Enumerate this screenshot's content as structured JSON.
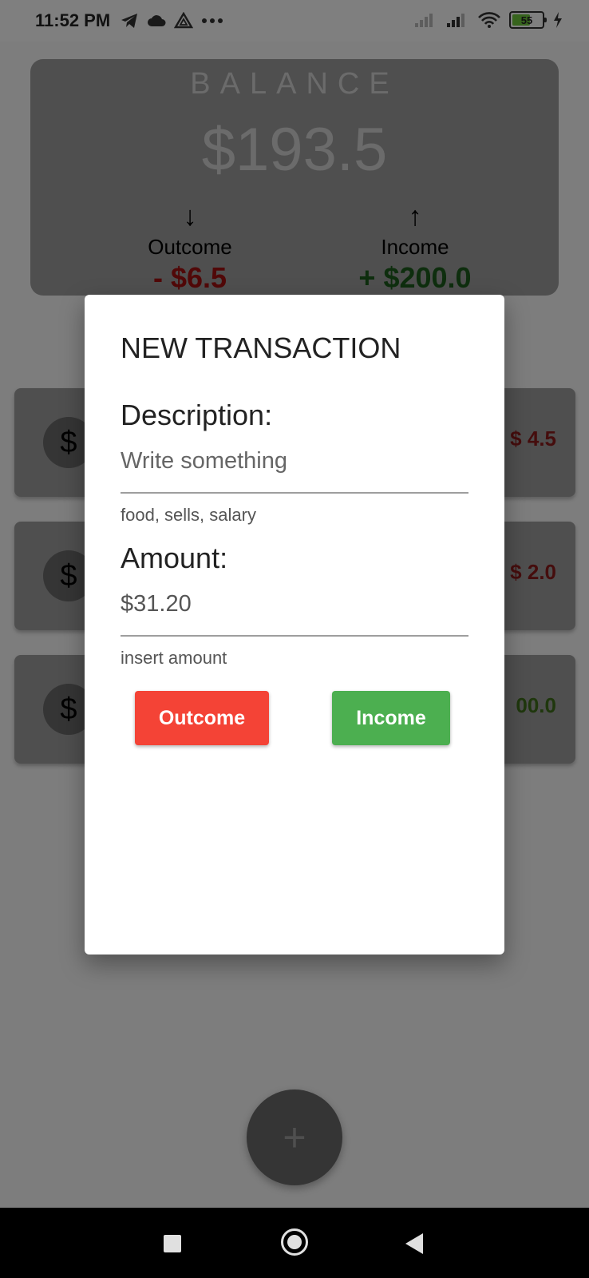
{
  "status": {
    "time": "11:52 PM",
    "battery": "55"
  },
  "balance": {
    "title": "BALANCE",
    "amount": "$193.5",
    "outcome_label": "Outcome",
    "outcome_value": "- $6.5",
    "income_label": "Income",
    "income_value": "+ $200.0"
  },
  "transactions": [
    {
      "icon": "$",
      "amount": "$ 4.5"
    },
    {
      "icon": "$",
      "amount": "$ 2.0"
    },
    {
      "icon": "$",
      "amount": "00.0"
    }
  ],
  "fab": {
    "label": "+"
  },
  "dialog": {
    "title": "NEW TRANSACTION",
    "description_label": "Description:",
    "description_placeholder": "Write something",
    "description_hint": "food, sells, salary",
    "amount_label": "Amount:",
    "amount_value": "$31.20",
    "amount_hint": "insert amount",
    "outcome_button": "Outcome",
    "income_button": "Income"
  },
  "colors": {
    "outcome_button": "#f44336",
    "income_button": "#4caf50",
    "outcome_text": "#a31010",
    "income_text": "#1d5c1d"
  },
  "icons": [
    "telegram-icon",
    "cloud-icon",
    "drive-icon",
    "more-icon",
    "signal-icon",
    "wifi-icon",
    "battery-icon",
    "charging-icon",
    "arrow-down-icon",
    "arrow-up-icon",
    "dollar-icon",
    "plus-icon",
    "recents-icon",
    "home-icon",
    "back-icon"
  ]
}
